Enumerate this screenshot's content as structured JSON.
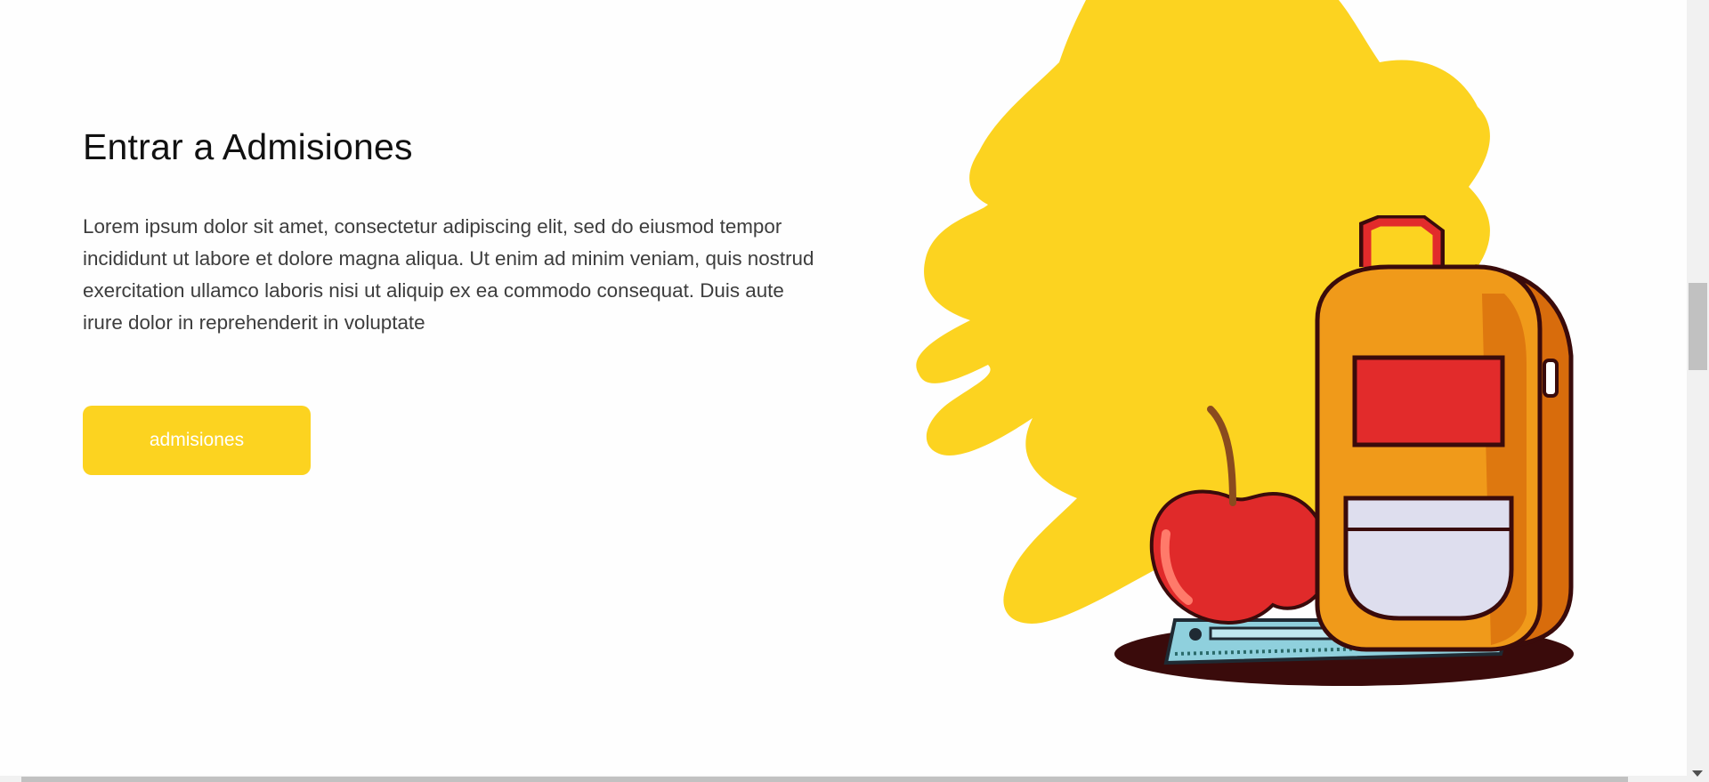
{
  "section": {
    "title": "Entrar a Admisiones",
    "body": "Lorem ipsum dolor sit amet, consectetur adipiscing elit, sed do eiusmod tempor incididunt ut labore et dolore magna aliqua. Ut enim ad minim veniam, quis nostrud exercitation ullamco laboris nisi ut aliquip ex ea commodo consequat. Duis aute irure dolor in reprehenderit in voluptate",
    "button_label": "admisiones"
  },
  "illustration": {
    "icons": [
      "paint-splash",
      "backpack-icon",
      "apple-icon",
      "ruler-icon"
    ]
  },
  "colors": {
    "accent": "#fcd320",
    "title": "#111111",
    "body": "#3d3d3d",
    "button_text": "#ffffff",
    "backpack_orange": "#f09a1a",
    "backpack_red": "#e22b2b",
    "pocket_gray": "#dedeee",
    "apple_red": "#e02a2a",
    "ruler_blue": "#8fd0dd",
    "shadow": "#3a0b0b"
  }
}
